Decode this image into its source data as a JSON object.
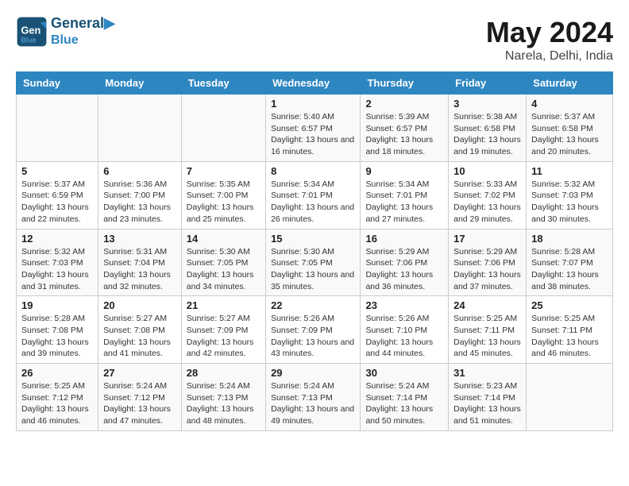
{
  "header": {
    "logo_line1": "General",
    "logo_line2": "Blue",
    "month_year": "May 2024",
    "location": "Narela, Delhi, India"
  },
  "days_of_week": [
    "Sunday",
    "Monday",
    "Tuesday",
    "Wednesday",
    "Thursday",
    "Friday",
    "Saturday"
  ],
  "weeks": [
    [
      {
        "day": "",
        "sunrise": "",
        "sunset": "",
        "daylight": ""
      },
      {
        "day": "",
        "sunrise": "",
        "sunset": "",
        "daylight": ""
      },
      {
        "day": "",
        "sunrise": "",
        "sunset": "",
        "daylight": ""
      },
      {
        "day": "1",
        "sunrise": "Sunrise: 5:40 AM",
        "sunset": "Sunset: 6:57 PM",
        "daylight": "Daylight: 13 hours and 16 minutes."
      },
      {
        "day": "2",
        "sunrise": "Sunrise: 5:39 AM",
        "sunset": "Sunset: 6:57 PM",
        "daylight": "Daylight: 13 hours and 18 minutes."
      },
      {
        "day": "3",
        "sunrise": "Sunrise: 5:38 AM",
        "sunset": "Sunset: 6:58 PM",
        "daylight": "Daylight: 13 hours and 19 minutes."
      },
      {
        "day": "4",
        "sunrise": "Sunrise: 5:37 AM",
        "sunset": "Sunset: 6:58 PM",
        "daylight": "Daylight: 13 hours and 20 minutes."
      }
    ],
    [
      {
        "day": "5",
        "sunrise": "Sunrise: 5:37 AM",
        "sunset": "Sunset: 6:59 PM",
        "daylight": "Daylight: 13 hours and 22 minutes."
      },
      {
        "day": "6",
        "sunrise": "Sunrise: 5:36 AM",
        "sunset": "Sunset: 7:00 PM",
        "daylight": "Daylight: 13 hours and 23 minutes."
      },
      {
        "day": "7",
        "sunrise": "Sunrise: 5:35 AM",
        "sunset": "Sunset: 7:00 PM",
        "daylight": "Daylight: 13 hours and 25 minutes."
      },
      {
        "day": "8",
        "sunrise": "Sunrise: 5:34 AM",
        "sunset": "Sunset: 7:01 PM",
        "daylight": "Daylight: 13 hours and 26 minutes."
      },
      {
        "day": "9",
        "sunrise": "Sunrise: 5:34 AM",
        "sunset": "Sunset: 7:01 PM",
        "daylight": "Daylight: 13 hours and 27 minutes."
      },
      {
        "day": "10",
        "sunrise": "Sunrise: 5:33 AM",
        "sunset": "Sunset: 7:02 PM",
        "daylight": "Daylight: 13 hours and 29 minutes."
      },
      {
        "day": "11",
        "sunrise": "Sunrise: 5:32 AM",
        "sunset": "Sunset: 7:03 PM",
        "daylight": "Daylight: 13 hours and 30 minutes."
      }
    ],
    [
      {
        "day": "12",
        "sunrise": "Sunrise: 5:32 AM",
        "sunset": "Sunset: 7:03 PM",
        "daylight": "Daylight: 13 hours and 31 minutes."
      },
      {
        "day": "13",
        "sunrise": "Sunrise: 5:31 AM",
        "sunset": "Sunset: 7:04 PM",
        "daylight": "Daylight: 13 hours and 32 minutes."
      },
      {
        "day": "14",
        "sunrise": "Sunrise: 5:30 AM",
        "sunset": "Sunset: 7:05 PM",
        "daylight": "Daylight: 13 hours and 34 minutes."
      },
      {
        "day": "15",
        "sunrise": "Sunrise: 5:30 AM",
        "sunset": "Sunset: 7:05 PM",
        "daylight": "Daylight: 13 hours and 35 minutes."
      },
      {
        "day": "16",
        "sunrise": "Sunrise: 5:29 AM",
        "sunset": "Sunset: 7:06 PM",
        "daylight": "Daylight: 13 hours and 36 minutes."
      },
      {
        "day": "17",
        "sunrise": "Sunrise: 5:29 AM",
        "sunset": "Sunset: 7:06 PM",
        "daylight": "Daylight: 13 hours and 37 minutes."
      },
      {
        "day": "18",
        "sunrise": "Sunrise: 5:28 AM",
        "sunset": "Sunset: 7:07 PM",
        "daylight": "Daylight: 13 hours and 38 minutes."
      }
    ],
    [
      {
        "day": "19",
        "sunrise": "Sunrise: 5:28 AM",
        "sunset": "Sunset: 7:08 PM",
        "daylight": "Daylight: 13 hours and 39 minutes."
      },
      {
        "day": "20",
        "sunrise": "Sunrise: 5:27 AM",
        "sunset": "Sunset: 7:08 PM",
        "daylight": "Daylight: 13 hours and 41 minutes."
      },
      {
        "day": "21",
        "sunrise": "Sunrise: 5:27 AM",
        "sunset": "Sunset: 7:09 PM",
        "daylight": "Daylight: 13 hours and 42 minutes."
      },
      {
        "day": "22",
        "sunrise": "Sunrise: 5:26 AM",
        "sunset": "Sunset: 7:09 PM",
        "daylight": "Daylight: 13 hours and 43 minutes."
      },
      {
        "day": "23",
        "sunrise": "Sunrise: 5:26 AM",
        "sunset": "Sunset: 7:10 PM",
        "daylight": "Daylight: 13 hours and 44 minutes."
      },
      {
        "day": "24",
        "sunrise": "Sunrise: 5:25 AM",
        "sunset": "Sunset: 7:11 PM",
        "daylight": "Daylight: 13 hours and 45 minutes."
      },
      {
        "day": "25",
        "sunrise": "Sunrise: 5:25 AM",
        "sunset": "Sunset: 7:11 PM",
        "daylight": "Daylight: 13 hours and 46 minutes."
      }
    ],
    [
      {
        "day": "26",
        "sunrise": "Sunrise: 5:25 AM",
        "sunset": "Sunset: 7:12 PM",
        "daylight": "Daylight: 13 hours and 46 minutes."
      },
      {
        "day": "27",
        "sunrise": "Sunrise: 5:24 AM",
        "sunset": "Sunset: 7:12 PM",
        "daylight": "Daylight: 13 hours and 47 minutes."
      },
      {
        "day": "28",
        "sunrise": "Sunrise: 5:24 AM",
        "sunset": "Sunset: 7:13 PM",
        "daylight": "Daylight: 13 hours and 48 minutes."
      },
      {
        "day": "29",
        "sunrise": "Sunrise: 5:24 AM",
        "sunset": "Sunset: 7:13 PM",
        "daylight": "Daylight: 13 hours and 49 minutes."
      },
      {
        "day": "30",
        "sunrise": "Sunrise: 5:24 AM",
        "sunset": "Sunset: 7:14 PM",
        "daylight": "Daylight: 13 hours and 50 minutes."
      },
      {
        "day": "31",
        "sunrise": "Sunrise: 5:23 AM",
        "sunset": "Sunset: 7:14 PM",
        "daylight": "Daylight: 13 hours and 51 minutes."
      },
      {
        "day": "",
        "sunrise": "",
        "sunset": "",
        "daylight": ""
      }
    ]
  ]
}
